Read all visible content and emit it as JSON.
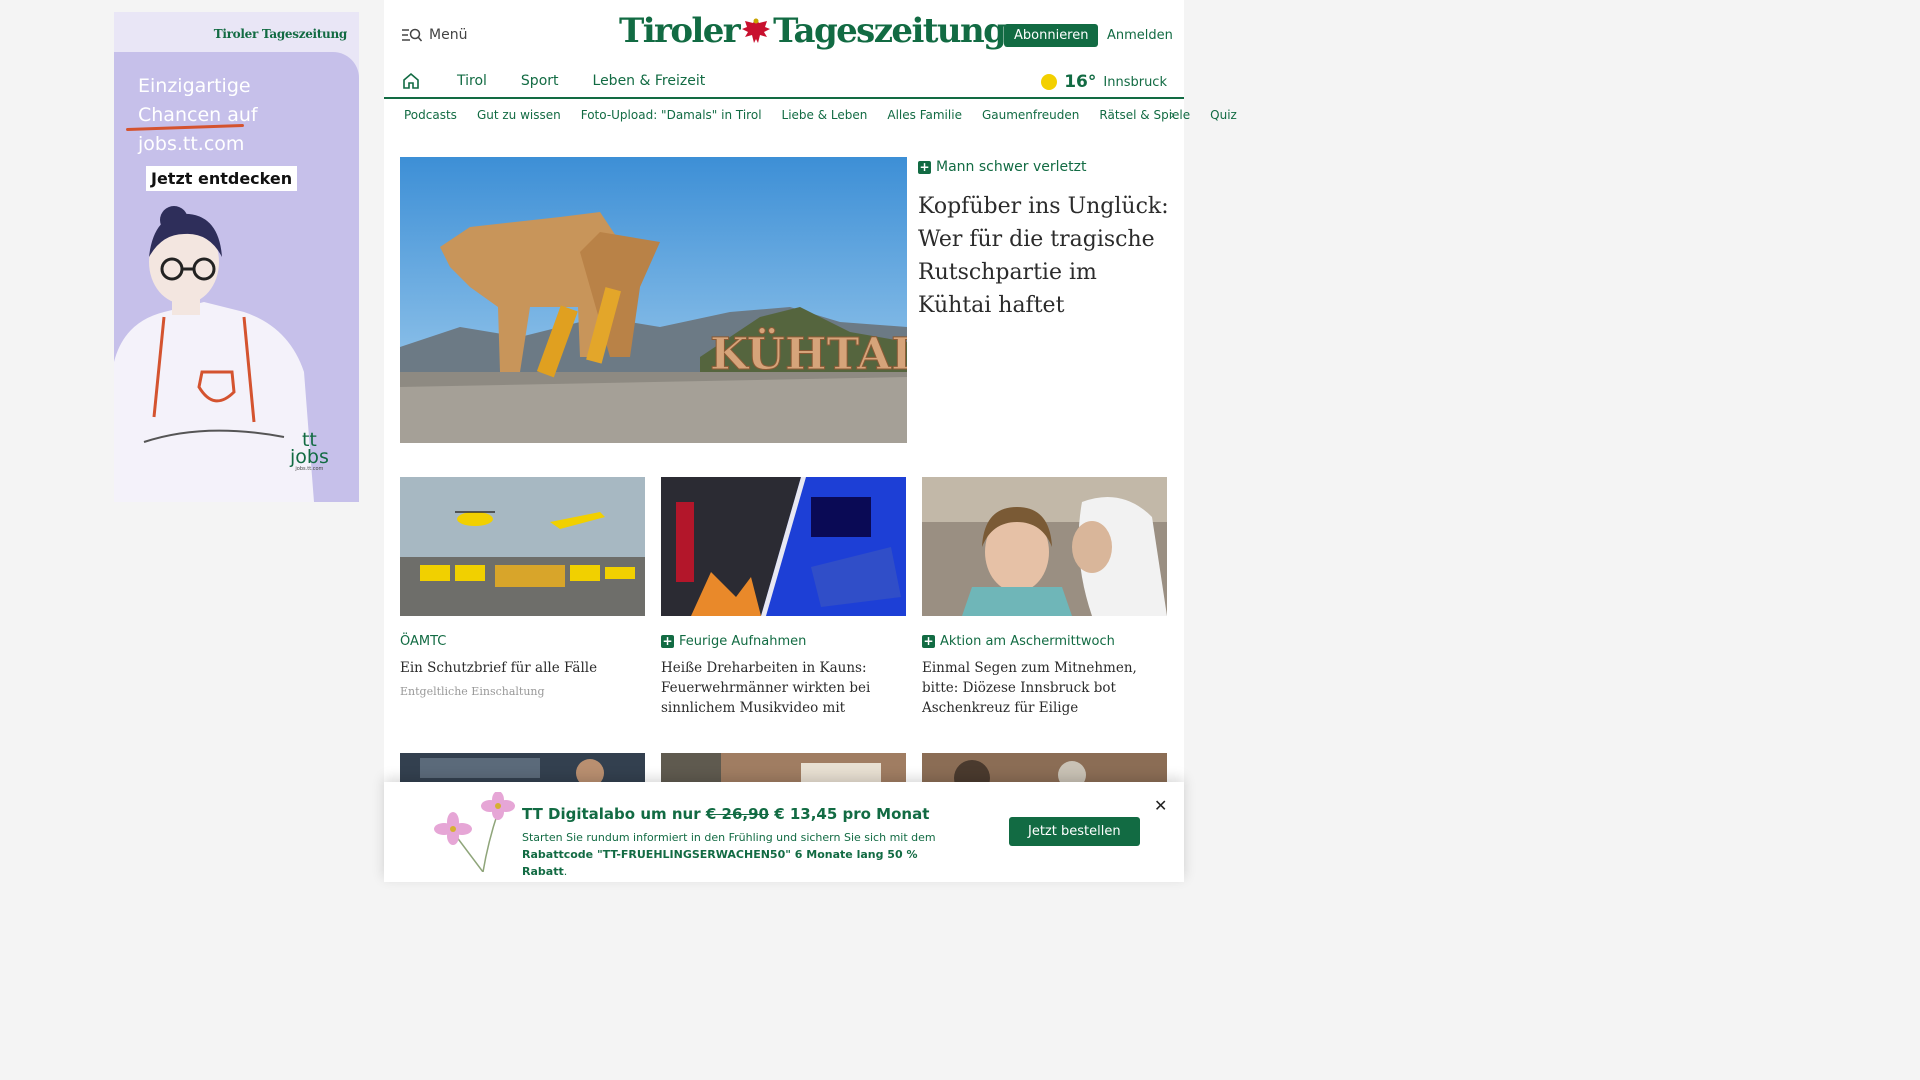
{
  "ad": {
    "logo": "Tiroler Tageszeitung",
    "headline": "Einzigartige Chancen auf jobs.tt.com",
    "cta": "Jetzt entdecken",
    "brand_top": "tt",
    "brand_bottom": "jobs",
    "brand_url": "jobs.tt.com"
  },
  "header": {
    "menu_label": "Menü",
    "logo_left": "Tiroler",
    "logo_right": "Tageszeitung",
    "subscribe_label": "Abonnieren",
    "login_label": "Anmelden"
  },
  "nav": {
    "items": [
      "Tirol",
      "Sport",
      "Leben & Freizeit"
    ],
    "weather": {
      "temp": "16°",
      "city": "Innsbruck",
      "icon": "sun-icon"
    }
  },
  "subnav": [
    "Podcasts",
    "Gut zu wissen",
    "Foto-Upload: \"Damals\" in Tirol",
    "Liebe & Leben",
    "Alles Familie",
    "Gaumenfreuden",
    "Rätsel & Spiele",
    "Quiz"
  ],
  "hero": {
    "kicker": "Mann schwer verletzt",
    "title": "Kopfüber ins Unglück: Wer für die tragische Rutschpartie im Kühtai haftet",
    "image_text": "KÜHTAI"
  },
  "cards": [
    {
      "kicker": "ÖAMTC",
      "premium": false,
      "title": "Ein Schutzbrief für alle Fälle",
      "note": "Entgeltliche Einschaltung"
    },
    {
      "kicker": "Feurige Aufnahmen",
      "premium": true,
      "title": "Heiße Dreharbeiten in Kauns: Feuerwehrmänner wirkten bei sinnlichem Musikvideo mit",
      "note": ""
    },
    {
      "kicker": "Aktion am Aschermittwoch",
      "premium": true,
      "title": "Einmal Segen zum Mitnehmen, bitte: Diözese Innsbruck bot Aschenkreuz für Eilige",
      "note": ""
    }
  ],
  "promo": {
    "title_prefix": "TT Digitalabo um nur",
    "old_price": "€ 26,90",
    "new_price": "€ 13,45 pro Monat",
    "text": "Starten Sie rundum informiert in den Frühling und sichern Sie sich mit dem",
    "code_text": "Rabattcode \"TT-FRUEHLINGSERWACHEN50\" 6 Monate lang 50 % Rabatt",
    "button_label": "Jetzt bestellen",
    "close_label": "✕"
  },
  "colors": {
    "brand_green": "#126b43",
    "ad_lilac": "#c6c0ea",
    "accent_yellow": "#f3d000"
  }
}
